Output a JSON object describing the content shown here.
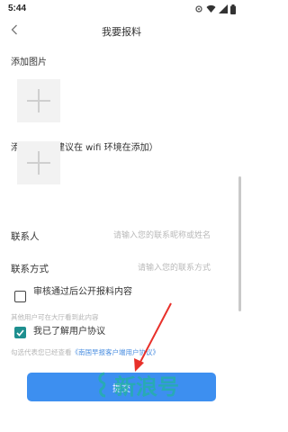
{
  "status_bar": {
    "time": "5:44"
  },
  "header": {
    "title": "我要报料"
  },
  "sections": {
    "image_label": "添加图片",
    "video_label": "添加视频（建议在 wifi 环境在添加）"
  },
  "form": {
    "contact_label": "联系人",
    "contact_placeholder": "请输入您的联系昵称或姓名",
    "method_label": "联系方式",
    "method_placeholder": "请输入您的联系方式"
  },
  "options": {
    "public_label": "审核通过后公开报料内容",
    "public_checked": false,
    "public_hint": "其他用户可在大厅看到此内容",
    "agree_label": "我已了解用户协议",
    "agree_checked": true,
    "agree_prefix": "勾选代表您已经查看",
    "agree_link": "《南国早报客户端用户协议》"
  },
  "submit": {
    "label": "提交"
  },
  "watermark": {
    "text": "新浪号"
  },
  "colors": {
    "accent": "#3d8ff0",
    "check": "#1e8f8f",
    "arrow": "#e8302a"
  },
  "icons": [
    "back-arrow-icon",
    "plus-icon",
    "check-icon",
    "wifi-icon",
    "signal-icon",
    "battery-icon",
    "settings-icon",
    "red-arrow-icon"
  ]
}
